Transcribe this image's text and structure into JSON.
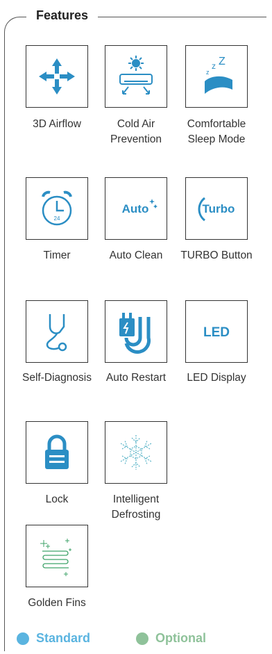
{
  "title": "Features",
  "features": [
    {
      "label": "3D Airflow",
      "icon": "airflow-arrows-icon"
    },
    {
      "label": "Cold Air Prevention",
      "icon": "cold-air-prevention-icon"
    },
    {
      "label": "Comfortable Sleep Mode",
      "icon": "sleep-mode-icon"
    },
    {
      "label": "Timer",
      "icon": "alarm-clock-icon"
    },
    {
      "label": "Auto Clean",
      "icon": "auto-clean-icon",
      "icon_text": "Auto"
    },
    {
      "label": "TURBO Button",
      "icon": "turbo-icon",
      "icon_text": "Turbo"
    },
    {
      "label": "Self-Diagnosis",
      "icon": "stethoscope-icon"
    },
    {
      "label": "Auto Restart",
      "icon": "plug-restart-icon"
    },
    {
      "label": "LED Display",
      "icon": "led-icon",
      "icon_text": "LED"
    },
    {
      "label": "Lock",
      "icon": "padlock-icon"
    },
    {
      "label": "Intelligent Defrosting",
      "icon": "snowflake-icon"
    },
    {
      "label": "Golden Fins",
      "icon": "golden-fins-icon"
    }
  ],
  "timer_icon_text": "24",
  "legend": [
    {
      "label": "Standard",
      "color": "#5ab4e0"
    },
    {
      "label": "Optional",
      "color": "#8fc29a"
    }
  ],
  "colors": {
    "accent": "#2b8ec4",
    "border": "#333333"
  }
}
